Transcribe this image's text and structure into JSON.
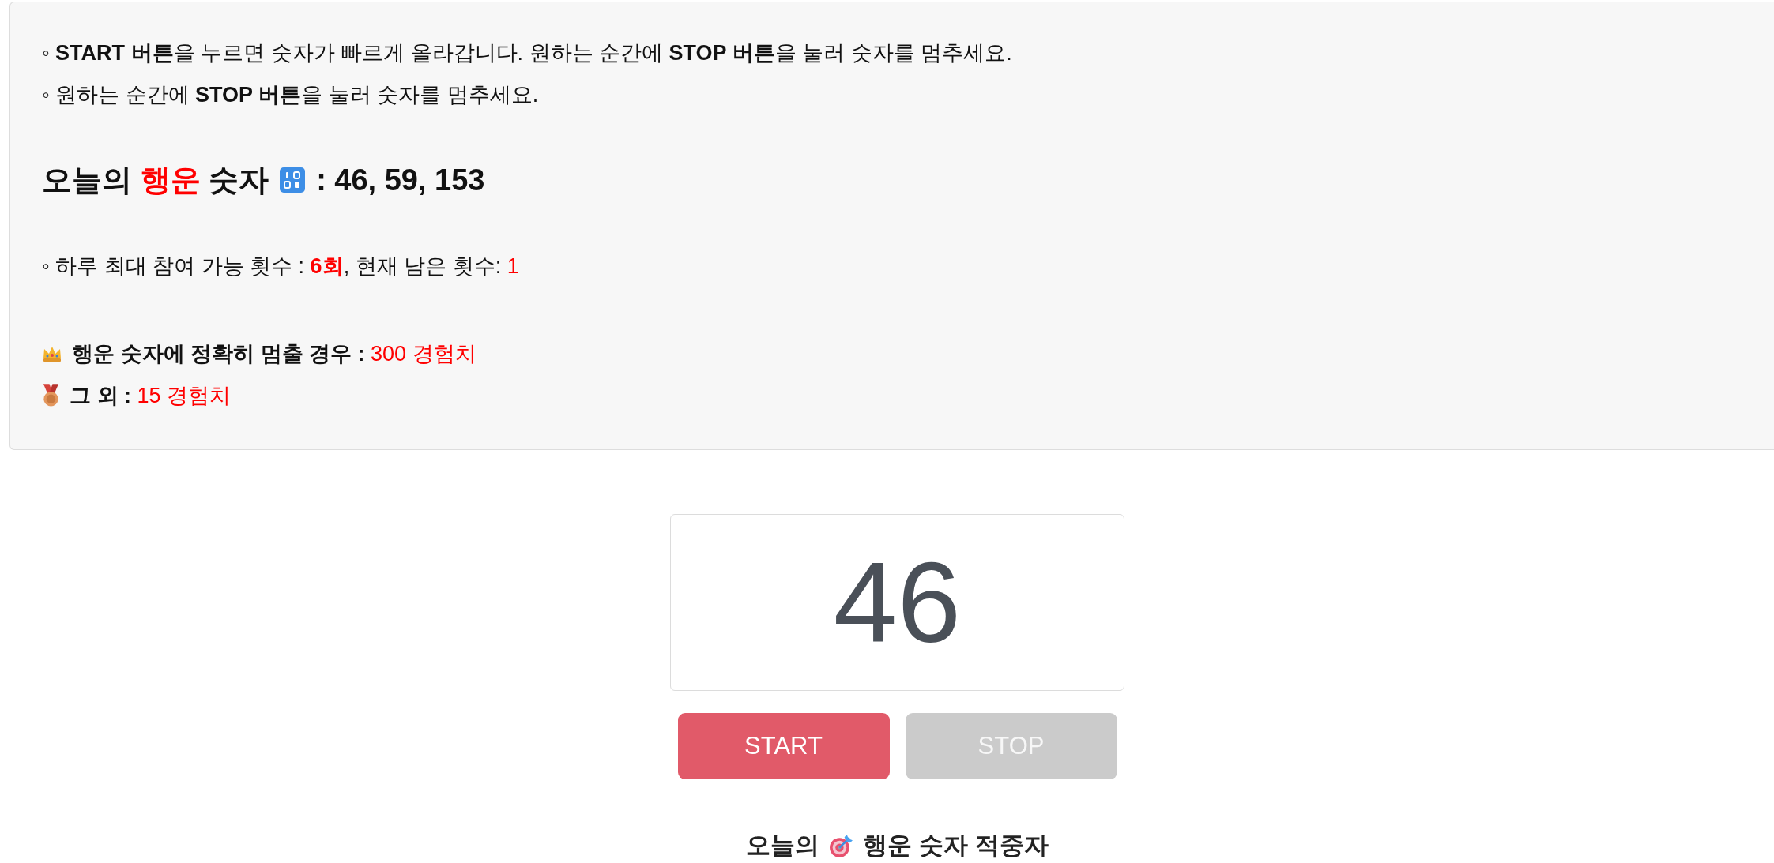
{
  "instructions": [
    "◦ **START 버튼**을 누르면 숫자가 빠르게 올라갑니다. 원하는 순간에 **STOP 버튼**을 눌러 숫자를 멈추세요.",
    "◦ 원하는 순간에 **STOP 버튼**을 눌러 숫자를 멈추세요."
  ],
  "lucky_heading": {
    "title": [
      {
        "text": "오늘의 ",
        "kind": "normal"
      },
      {
        "text": "행운",
        "kind": "accent"
      },
      {
        "text": " 숫자",
        "kind": "normal"
      }
    ],
    "numbers": ": 46, 59, 153"
  },
  "attempts": [
    {
      "text": "◦ 하루 최대 참여 가능 횟수 : ",
      "kind": "normal"
    },
    {
      "text": "6회",
      "kind": "strong-accent"
    },
    {
      "text": ", 현재 남은 횟수: ",
      "kind": "normal"
    },
    {
      "text": "1",
      "kind": "accent"
    }
  ],
  "rewards": [
    {
      "kind": "crown",
      "segments": [
        {
          "text": "행운 숫자에 정확히 멈출 경우 : ",
          "kind": "normal"
        },
        {
          "text": "300 경험치",
          "kind": "accent"
        }
      ]
    },
    {
      "kind": "medal",
      "segments": [
        {
          "text": "그 외 : ",
          "kind": "normal"
        },
        {
          "text": "15 경험치",
          "kind": "accent"
        }
      ]
    }
  ],
  "counter": {
    "value": "46"
  },
  "buttons": [
    {
      "label": "START",
      "disabled": false
    },
    {
      "label": "STOP",
      "disabled": true
    }
  ],
  "winners_heading": {
    "before": "오늘의",
    "after": "행운 숫자 적중자"
  }
}
